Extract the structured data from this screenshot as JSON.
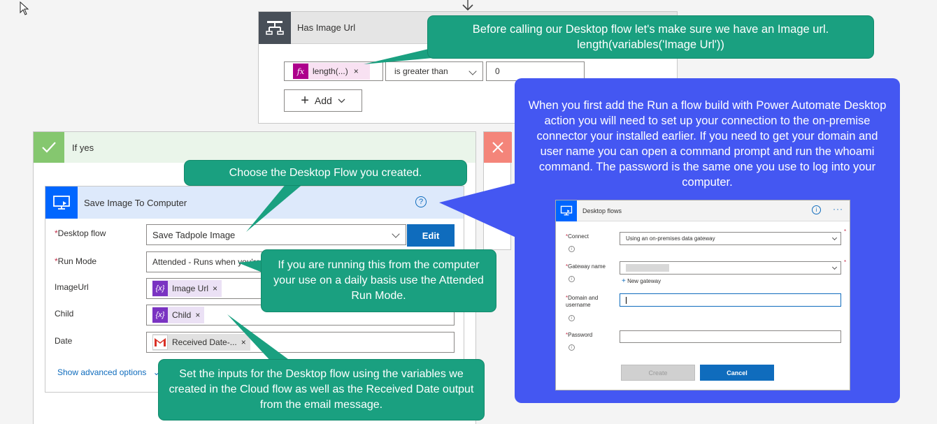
{
  "condition": {
    "title": "Has Image Url",
    "token_label": "length(...)",
    "operator": "is greater than",
    "value": "0",
    "add_label": "Add"
  },
  "if_yes": {
    "title": "If yes"
  },
  "action": {
    "title": "Save Image To Computer",
    "fields": {
      "desktop_flow_label": "Desktop flow",
      "desktop_flow_value": "Save Tadpole Image",
      "edit_label": "Edit",
      "run_mode_label": "Run Mode",
      "run_mode_value": "Attended - Runs when you're",
      "imageurl_label": "ImageUrl",
      "imageurl_token": "Image Url",
      "child_label": "Child",
      "child_token": "Child",
      "date_label": "Date",
      "date_token": "Received Date-..."
    },
    "advanced_link": "Show advanced options"
  },
  "callouts": {
    "condition_line1": "Before calling our Desktop flow let's make sure we have an Image url.",
    "condition_line2": "length(variables('Image Url'))",
    "choose_flow": "Choose the Desktop Flow you created.",
    "run_mode": "If you are running this from the computer your use on a daily basis use the Attended Run Mode.",
    "inputs": "Set the inputs for the Desktop flow using the variables we created in the Cloud flow as well as the Received Date output from the email message.",
    "connection": "When you first add the Run a flow build with Power Automate Desktop action you will need to set up your connection to the on-premise connector your installed earlier. If you need to get your domain and user name you can open a command prompt and run the whoami command.  The password is the same one you use to log into your computer."
  },
  "dialog": {
    "title": "Desktop flows",
    "more": "···",
    "connect_label": "Connect",
    "connect_value": "Using an on-premises data gateway",
    "gateway_label": "Gateway name",
    "new_gateway": "New gateway",
    "domain_label_1": "Domain and",
    "domain_label_2": "username",
    "password_label": "Password",
    "create_label": "Create",
    "cancel_label": "Cancel"
  },
  "colors": {
    "callout_green": "#1aa080",
    "callout_blue": "#4457f2",
    "primary": "#0f6cbd",
    "action_accent": "#0066ff",
    "yes_green": "#85c76f",
    "no_red": "#f4857a"
  }
}
